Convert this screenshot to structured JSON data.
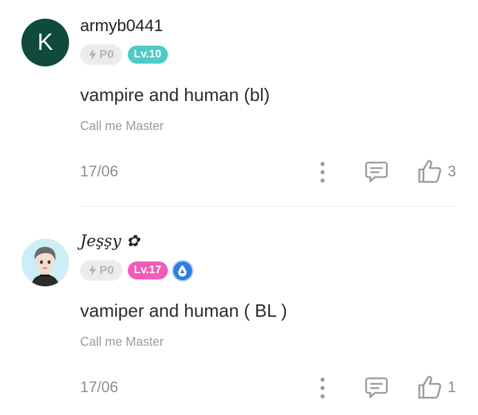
{
  "comments": [
    {
      "avatar_letter": "K",
      "username": "armyb0441",
      "points_badge": "P0",
      "level_badge": "Lv.10",
      "title": "vampire and human (bl)",
      "subtitle": "Call me Master",
      "date": "17/06",
      "likes": "3"
    },
    {
      "username": "Jeşşy ✿",
      "points_badge": "P0",
      "level_badge": "Lv.17",
      "title": "vamiper and human ( BL )",
      "subtitle": "Call me Master",
      "date": "17/06",
      "likes": "1"
    }
  ],
  "icons": {
    "points": "lightning-icon",
    "more": "more-vertical-icon",
    "reply": "comment-icon",
    "like": "thumbs-up-icon",
    "special_badge": "drop-badge-icon"
  },
  "colors": {
    "avatar_k": "#0f4a3c",
    "level_teal": "#4ccbc9",
    "level_pink": "#f25bb6",
    "icon_gray": "#9b9b9b"
  }
}
